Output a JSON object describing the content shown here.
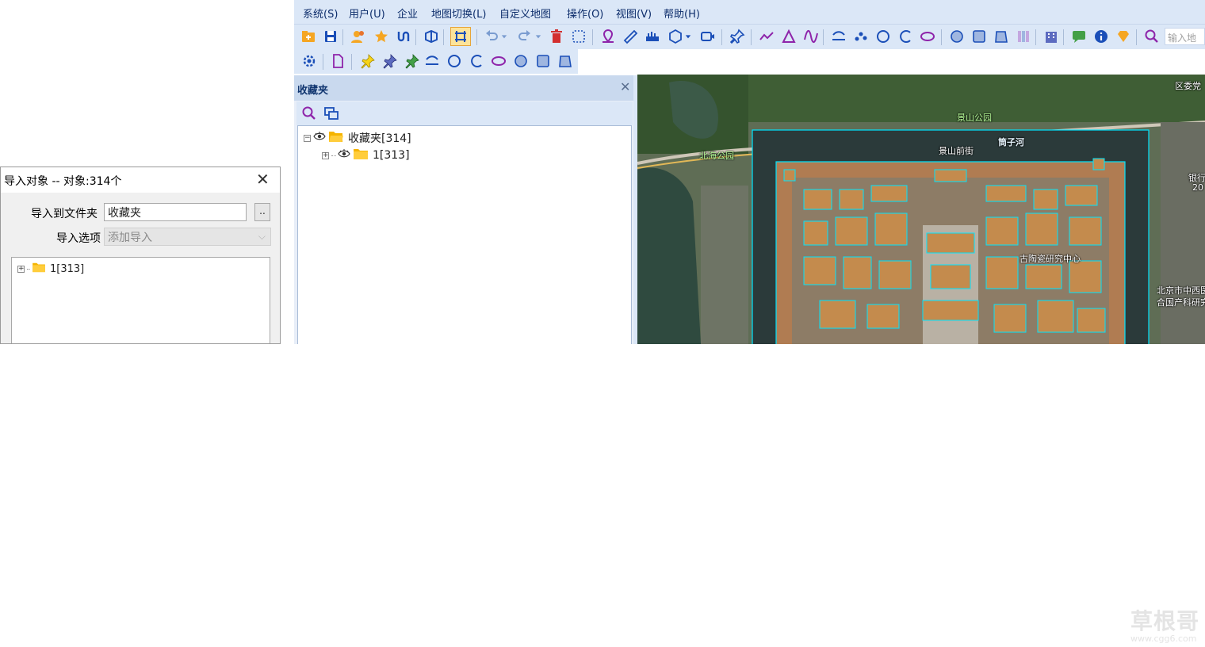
{
  "menu": [
    "系统(S)",
    "用户(U)",
    "企业",
    "地图切换(L)",
    "自定义地图",
    "操作(O)",
    "视图(V)",
    "帮助(H)"
  ],
  "toolbar": {
    "search_placeholder": "输入地"
  },
  "favorites_panel": {
    "title": "收藏夹",
    "close_glyph": "✕",
    "tree": [
      {
        "label": "收藏夹[314]",
        "expanded": true
      },
      {
        "label": "1[313]",
        "expanded": false
      }
    ]
  },
  "map": {
    "labels": {
      "jingshan_park": "景山公园",
      "beihai_park": "北海公园",
      "jingshan_front_st": "景山前街",
      "tongzihe": "筒子河",
      "palace_research": "古陶瓷研究中心",
      "district": "区委党",
      "beijing_city": "北京市中西医",
      "integrated_research": "合国产科研究",
      "bank": "银行",
      "num": "20"
    }
  },
  "dialog": {
    "title": "导入对象 -- 对象:314个",
    "close_glyph": "✕",
    "folder_label": "导入到文件夹",
    "folder_value": "收藏夹",
    "browse_label": "..",
    "option_label": "导入选项",
    "option_value": "添加导入",
    "tree": [
      {
        "label": "1[313]"
      }
    ]
  },
  "watermark": {
    "main": "草根哥",
    "sub": "www.cgg6.com"
  },
  "colors": {
    "accent": "#0d2d6b",
    "toolbar_bg": "#dbe7f7",
    "selection": "#00e5ff"
  }
}
